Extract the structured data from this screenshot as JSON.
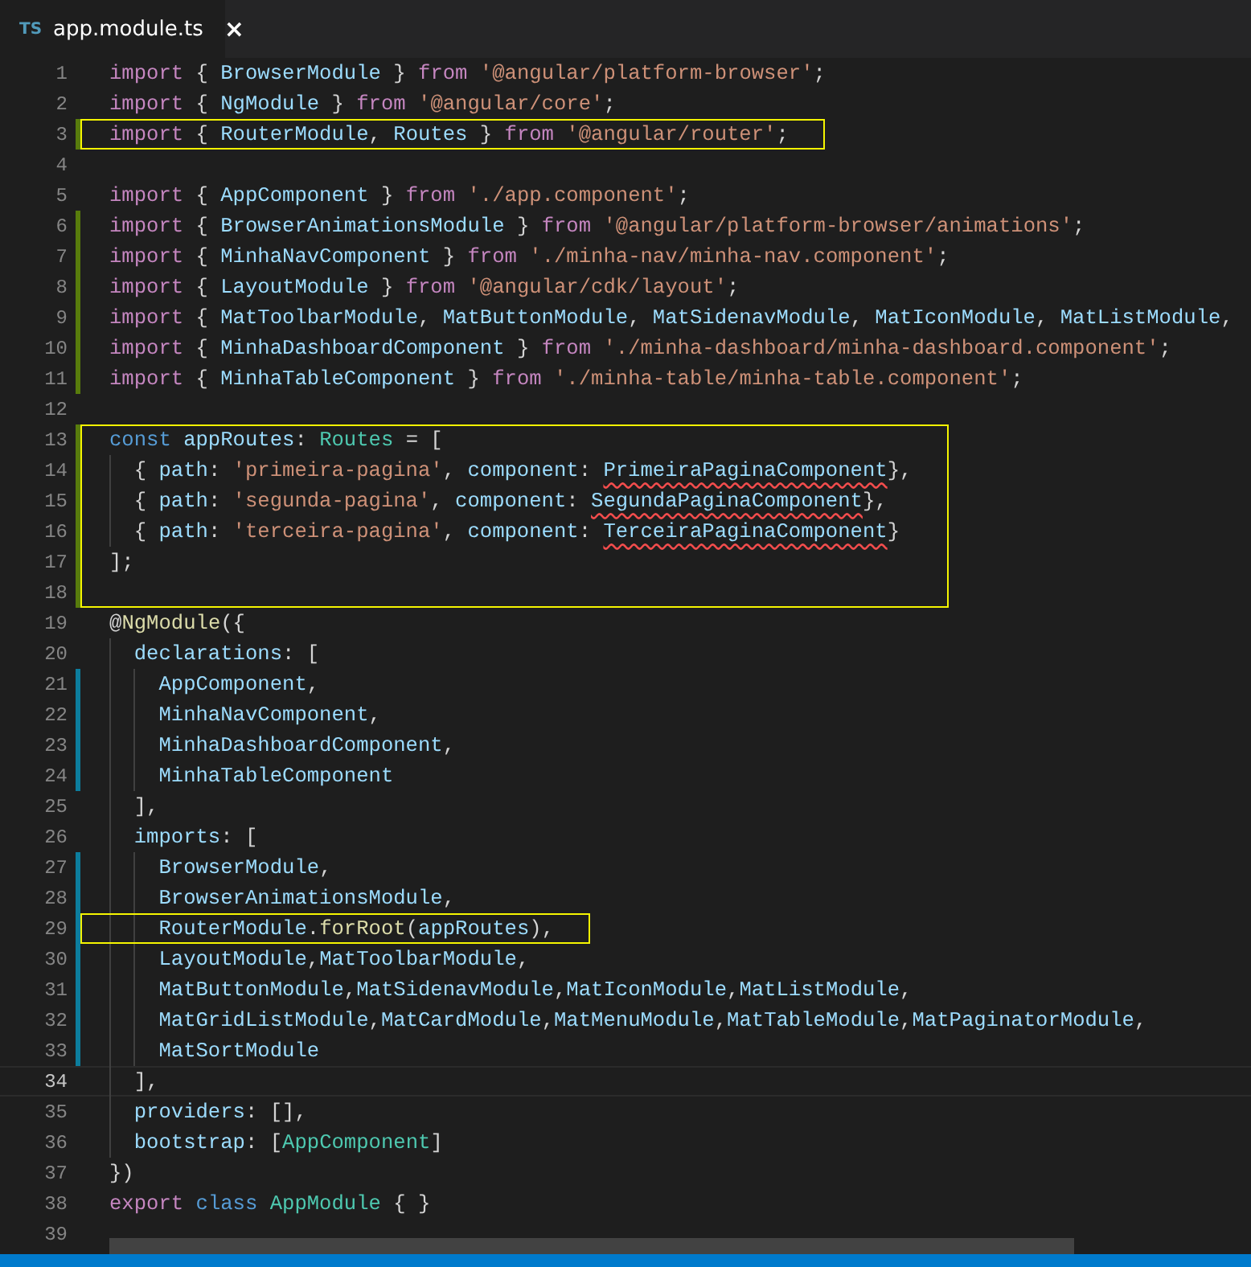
{
  "tab": {
    "icon_text": "TS",
    "title": "app.module.ts",
    "close": "×",
    "selected": true
  },
  "lines": [
    {
      "n": "1",
      "added": false,
      "modified": false,
      "current": false,
      "boxed": false,
      "tokens": [
        {
          "text": "import ",
          "kind": "keyword"
        },
        {
          "text": "{ ",
          "kind": "punct"
        },
        {
          "text": "BrowserModule",
          "kind": "ident"
        },
        {
          "text": " } ",
          "kind": "punct"
        },
        {
          "text": "from ",
          "kind": "keyword"
        },
        {
          "text": "'@angular/platform-browser'",
          "kind": "string"
        },
        {
          "text": ";",
          "kind": "punct"
        }
      ]
    },
    {
      "n": "2",
      "added": false,
      "modified": false,
      "current": false,
      "boxed": false,
      "tokens": [
        {
          "text": "import ",
          "kind": "keyword"
        },
        {
          "text": "{ ",
          "kind": "punct"
        },
        {
          "text": "NgModule",
          "kind": "ident"
        },
        {
          "text": " } ",
          "kind": "punct"
        },
        {
          "text": "from ",
          "kind": "keyword"
        },
        {
          "text": "'@angular/core'",
          "kind": "string"
        },
        {
          "text": ";",
          "kind": "punct"
        }
      ]
    },
    {
      "n": "3",
      "added": true,
      "modified": false,
      "current": false,
      "boxed": true,
      "tokens": [
        {
          "text": "import ",
          "kind": "keyword"
        },
        {
          "text": "{ ",
          "kind": "punct"
        },
        {
          "text": "RouterModule",
          "kind": "ident"
        },
        {
          "text": ", ",
          "kind": "punct"
        },
        {
          "text": "Routes",
          "kind": "ident"
        },
        {
          "text": " } ",
          "kind": "punct"
        },
        {
          "text": "from ",
          "kind": "keyword"
        },
        {
          "text": "'@angular/router'",
          "kind": "string"
        },
        {
          "text": ";",
          "kind": "punct"
        }
      ]
    },
    {
      "n": "4",
      "added": false,
      "modified": false,
      "current": false,
      "boxed": false
    },
    {
      "n": "5",
      "added": false,
      "modified": false,
      "current": false,
      "boxed": false,
      "tokens": [
        {
          "text": "import ",
          "kind": "keyword"
        },
        {
          "text": "{ ",
          "kind": "punct"
        },
        {
          "text": "AppComponent",
          "kind": "ident"
        },
        {
          "text": " } ",
          "kind": "punct"
        },
        {
          "text": "from ",
          "kind": "keyword"
        },
        {
          "text": "'./app.component'",
          "kind": "string"
        },
        {
          "text": ";",
          "kind": "punct"
        }
      ]
    },
    {
      "n": "6",
      "added": true,
      "modified": false,
      "current": false,
      "boxed": false,
      "tokens": [
        {
          "text": "import ",
          "kind": "keyword"
        },
        {
          "text": "{ ",
          "kind": "punct"
        },
        {
          "text": "BrowserAnimationsModule",
          "kind": "ident"
        },
        {
          "text": " } ",
          "kind": "punct"
        },
        {
          "text": "from ",
          "kind": "keyword"
        },
        {
          "text": "'@angular/platform-browser/animations'",
          "kind": "string"
        },
        {
          "text": ";",
          "kind": "punct"
        }
      ]
    },
    {
      "n": "7",
      "added": true,
      "modified": false,
      "current": false,
      "boxed": false,
      "tokens": [
        {
          "text": "import ",
          "kind": "keyword"
        },
        {
          "text": "{ ",
          "kind": "punct"
        },
        {
          "text": "MinhaNavComponent",
          "kind": "ident"
        },
        {
          "text": " } ",
          "kind": "punct"
        },
        {
          "text": "from ",
          "kind": "keyword"
        },
        {
          "text": "'./minha-nav/minha-nav.component'",
          "kind": "string"
        },
        {
          "text": ";",
          "kind": "punct"
        }
      ]
    },
    {
      "n": "8",
      "added": true,
      "modified": false,
      "current": false,
      "boxed": false,
      "tokens": [
        {
          "text": "import ",
          "kind": "keyword"
        },
        {
          "text": "{ ",
          "kind": "punct"
        },
        {
          "text": "LayoutModule",
          "kind": "ident"
        },
        {
          "text": " } ",
          "kind": "punct"
        },
        {
          "text": "from ",
          "kind": "keyword"
        },
        {
          "text": "'@angular/cdk/layout'",
          "kind": "string"
        },
        {
          "text": ";",
          "kind": "punct"
        }
      ]
    },
    {
      "n": "9",
      "added": true,
      "modified": false,
      "current": false,
      "boxed": false,
      "tokens": [
        {
          "text": "import ",
          "kind": "keyword"
        },
        {
          "text": "{ ",
          "kind": "punct"
        },
        {
          "text": "MatToolbarModule",
          "kind": "ident"
        },
        {
          "text": ", ",
          "kind": "punct"
        },
        {
          "text": "MatButtonModule",
          "kind": "ident"
        },
        {
          "text": ", ",
          "kind": "punct"
        },
        {
          "text": "MatSidenavModule",
          "kind": "ident"
        },
        {
          "text": ", ",
          "kind": "punct"
        },
        {
          "text": "MatIconModule",
          "kind": "ident"
        },
        {
          "text": ", ",
          "kind": "punct"
        },
        {
          "text": "MatListModule",
          "kind": "ident"
        },
        {
          "text": ",",
          "kind": "punct"
        }
      ]
    },
    {
      "n": "10",
      "added": true,
      "modified": false,
      "current": false,
      "boxed": false,
      "tokens": [
        {
          "text": "import ",
          "kind": "keyword"
        },
        {
          "text": "{ ",
          "kind": "punct"
        },
        {
          "text": "MinhaDashboardComponent",
          "kind": "ident"
        },
        {
          "text": " } ",
          "kind": "punct"
        },
        {
          "text": "from ",
          "kind": "keyword"
        },
        {
          "text": "'./minha-dashboard/minha-dashboard.component'",
          "kind": "string"
        },
        {
          "text": ";",
          "kind": "punct"
        }
      ]
    },
    {
      "n": "11",
      "added": true,
      "modified": false,
      "current": false,
      "boxed": false,
      "tokens": [
        {
          "text": "import ",
          "kind": "keyword"
        },
        {
          "text": "{ ",
          "kind": "punct"
        },
        {
          "text": "MinhaTableComponent",
          "kind": "ident"
        },
        {
          "text": " } ",
          "kind": "punct"
        },
        {
          "text": "from ",
          "kind": "keyword"
        },
        {
          "text": "'./minha-table/minha-table.component'",
          "kind": "string"
        },
        {
          "text": ";",
          "kind": "punct"
        }
      ]
    },
    {
      "n": "12",
      "added": false,
      "modified": false,
      "current": false,
      "boxed": false
    },
    {
      "n": "13",
      "added": true,
      "modified": false,
      "current": false,
      "boxed": true,
      "tokens": [
        {
          "text": "const ",
          "kind": "storage"
        },
        {
          "text": "appRoutes",
          "kind": "ident"
        },
        {
          "text": ": ",
          "kind": "punct"
        },
        {
          "text": "Routes",
          "kind": "type"
        },
        {
          "text": " = [",
          "kind": "punct"
        }
      ]
    },
    {
      "n": "14",
      "added": true,
      "modified": false,
      "current": false,
      "boxed": true,
      "tokens": [
        {
          "text": "  { ",
          "kind": "punct"
        },
        {
          "text": "path",
          "kind": "ident"
        },
        {
          "text": ": ",
          "kind": "punct"
        },
        {
          "text": "'primeira-pagina'",
          "kind": "string"
        },
        {
          "text": ", ",
          "kind": "punct"
        },
        {
          "text": "component",
          "kind": "ident"
        },
        {
          "text": ": ",
          "kind": "punct"
        },
        {
          "text": "PrimeiraPaginaComponent",
          "kind": "error"
        },
        {
          "text": "},",
          "kind": "punct"
        }
      ]
    },
    {
      "n": "15",
      "added": true,
      "modified": false,
      "current": false,
      "boxed": true,
      "tokens": [
        {
          "text": "  { ",
          "kind": "punct"
        },
        {
          "text": "path",
          "kind": "ident"
        },
        {
          "text": ": ",
          "kind": "punct"
        },
        {
          "text": "'segunda-pagina'",
          "kind": "string"
        },
        {
          "text": ", ",
          "kind": "punct"
        },
        {
          "text": "component",
          "kind": "ident"
        },
        {
          "text": ": ",
          "kind": "punct"
        },
        {
          "text": "SegundaPaginaComponent",
          "kind": "error"
        },
        {
          "text": "},",
          "kind": "punct"
        }
      ]
    },
    {
      "n": "16",
      "added": true,
      "modified": false,
      "current": false,
      "boxed": true,
      "tokens": [
        {
          "text": "  { ",
          "kind": "punct"
        },
        {
          "text": "path",
          "kind": "ident"
        },
        {
          "text": ": ",
          "kind": "punct"
        },
        {
          "text": "'terceira-pagina'",
          "kind": "string"
        },
        {
          "text": ", ",
          "kind": "punct"
        },
        {
          "text": "component",
          "kind": "ident"
        },
        {
          "text": ": ",
          "kind": "punct"
        },
        {
          "text": "TerceiraPaginaComponent",
          "kind": "error"
        },
        {
          "text": "}",
          "kind": "punct"
        }
      ]
    },
    {
      "n": "17",
      "added": true,
      "modified": false,
      "current": false,
      "boxed": true,
      "tokens": [
        {
          "text": "];",
          "kind": "punct"
        }
      ]
    },
    {
      "n": "18",
      "added": true,
      "modified": false,
      "current": false,
      "boxed": true
    },
    {
      "n": "19",
      "added": false,
      "modified": false,
      "current": false,
      "boxed": false,
      "tokens": [
        {
          "text": "@",
          "kind": "punct"
        },
        {
          "text": "NgModule",
          "kind": "function"
        },
        {
          "text": "({",
          "kind": "punct"
        }
      ]
    },
    {
      "n": "20",
      "added": false,
      "modified": false,
      "current": false,
      "boxed": false,
      "tokens": [
        {
          "text": "  declarations",
          "kind": "ident"
        },
        {
          "text": ": [",
          "kind": "punct"
        }
      ]
    },
    {
      "n": "21",
      "added": false,
      "modified": true,
      "current": false,
      "boxed": false,
      "tokens": [
        {
          "text": "    AppComponent",
          "kind": "ident"
        },
        {
          "text": ",",
          "kind": "punct"
        }
      ]
    },
    {
      "n": "22",
      "added": false,
      "modified": true,
      "current": false,
      "boxed": false,
      "tokens": [
        {
          "text": "    MinhaNavComponent",
          "kind": "ident"
        },
        {
          "text": ",",
          "kind": "punct"
        }
      ]
    },
    {
      "n": "23",
      "added": false,
      "modified": true,
      "current": false,
      "boxed": false,
      "tokens": [
        {
          "text": "    MinhaDashboardComponent",
          "kind": "ident"
        },
        {
          "text": ",",
          "kind": "punct"
        }
      ]
    },
    {
      "n": "24",
      "added": false,
      "modified": true,
      "current": false,
      "boxed": false,
      "tokens": [
        {
          "text": "    MinhaTableComponent",
          "kind": "ident"
        }
      ]
    },
    {
      "n": "25",
      "added": false,
      "modified": false,
      "current": false,
      "boxed": false,
      "tokens": [
        {
          "text": "  ],",
          "kind": "punct"
        }
      ]
    },
    {
      "n": "26",
      "added": false,
      "modified": false,
      "current": false,
      "boxed": false,
      "tokens": [
        {
          "text": "  imports",
          "kind": "ident"
        },
        {
          "text": ": [",
          "kind": "punct"
        }
      ]
    },
    {
      "n": "27",
      "added": false,
      "modified": true,
      "current": false,
      "boxed": false,
      "tokens": [
        {
          "text": "    BrowserModule",
          "kind": "ident"
        },
        {
          "text": ",",
          "kind": "punct"
        }
      ]
    },
    {
      "n": "28",
      "added": false,
      "modified": true,
      "current": false,
      "boxed": false,
      "tokens": [
        {
          "text": "    BrowserAnimationsModule",
          "kind": "ident"
        },
        {
          "text": ",",
          "kind": "punct"
        }
      ]
    },
    {
      "n": "29",
      "added": false,
      "modified": true,
      "current": false,
      "boxed": true,
      "tokens": [
        {
          "text": "    RouterModule",
          "kind": "ident"
        },
        {
          "text": ".",
          "kind": "punct"
        },
        {
          "text": "forRoot",
          "kind": "function"
        },
        {
          "text": "(",
          "kind": "punct"
        },
        {
          "text": "appRoutes",
          "kind": "ident"
        },
        {
          "text": "),",
          "kind": "punct"
        }
      ]
    },
    {
      "n": "30",
      "added": false,
      "modified": true,
      "current": false,
      "boxed": false,
      "tokens": [
        {
          "text": "    LayoutModule",
          "kind": "ident"
        },
        {
          "text": ",",
          "kind": "punct"
        },
        {
          "text": "MatToolbarModule",
          "kind": "ident"
        },
        {
          "text": ",",
          "kind": "punct"
        }
      ]
    },
    {
      "n": "31",
      "added": false,
      "modified": true,
      "current": false,
      "boxed": false,
      "tokens": [
        {
          "text": "    MatButtonModule",
          "kind": "ident"
        },
        {
          "text": ",",
          "kind": "punct"
        },
        {
          "text": "MatSidenavModule",
          "kind": "ident"
        },
        {
          "text": ",",
          "kind": "punct"
        },
        {
          "text": "MatIconModule",
          "kind": "ident"
        },
        {
          "text": ",",
          "kind": "punct"
        },
        {
          "text": "MatListModule",
          "kind": "ident"
        },
        {
          "text": ",",
          "kind": "punct"
        }
      ]
    },
    {
      "n": "32",
      "added": false,
      "modified": true,
      "current": false,
      "boxed": false,
      "tokens": [
        {
          "text": "    MatGridListModule",
          "kind": "ident"
        },
        {
          "text": ",",
          "kind": "punct"
        },
        {
          "text": "MatCardModule",
          "kind": "ident"
        },
        {
          "text": ",",
          "kind": "punct"
        },
        {
          "text": "MatMenuModule",
          "kind": "ident"
        },
        {
          "text": ",",
          "kind": "punct"
        },
        {
          "text": "MatTableModule",
          "kind": "ident"
        },
        {
          "text": ",",
          "kind": "punct"
        },
        {
          "text": "MatPaginatorModule",
          "kind": "ident"
        },
        {
          "text": ",",
          "kind": "punct"
        }
      ]
    },
    {
      "n": "33",
      "added": false,
      "modified": true,
      "current": false,
      "boxed": false,
      "tokens": [
        {
          "text": "    MatSortModule",
          "kind": "ident"
        }
      ]
    },
    {
      "n": "34",
      "added": false,
      "modified": false,
      "current": true,
      "boxed": false,
      "tokens": [
        {
          "text": "  ],",
          "kind": "punct"
        }
      ]
    },
    {
      "n": "35",
      "added": false,
      "modified": false,
      "current": false,
      "boxed": false,
      "tokens": [
        {
          "text": "  providers",
          "kind": "ident"
        },
        {
          "text": ": [],",
          "kind": "punct"
        }
      ]
    },
    {
      "n": "36",
      "added": false,
      "modified": false,
      "current": false,
      "boxed": false,
      "tokens": [
        {
          "text": "  bootstrap",
          "kind": "ident"
        },
        {
          "text": ": [",
          "kind": "punct"
        },
        {
          "text": "AppComponent",
          "kind": "type"
        },
        {
          "text": "]",
          "kind": "punct"
        }
      ]
    },
    {
      "n": "37",
      "added": false,
      "modified": false,
      "current": false,
      "boxed": false,
      "tokens": [
        {
          "text": "})",
          "kind": "punct"
        }
      ]
    },
    {
      "n": "38",
      "added": false,
      "modified": false,
      "current": false,
      "boxed": false,
      "tokens": [
        {
          "text": "export ",
          "kind": "keyword"
        },
        {
          "text": "class ",
          "kind": "storage"
        },
        {
          "text": "AppModule",
          "kind": "type"
        },
        {
          "text": " { }",
          "kind": "punct"
        }
      ]
    },
    {
      "n": "39",
      "added": false,
      "modified": false,
      "current": false,
      "boxed": false
    }
  ]
}
